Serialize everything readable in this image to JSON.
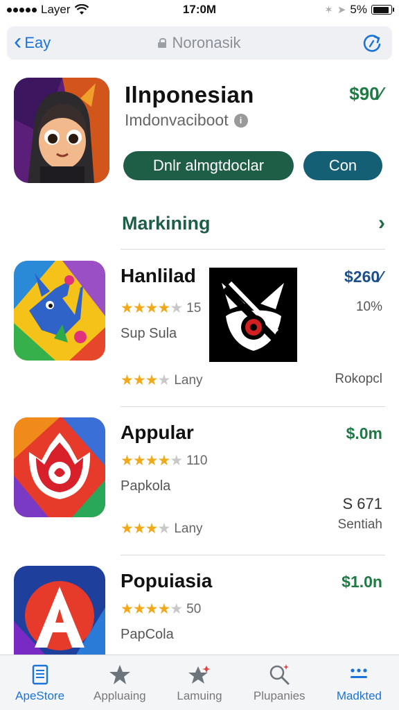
{
  "status_bar": {
    "carrier": "Layer",
    "time": "17:0M",
    "battery_percent_text": "5%"
  },
  "nav": {
    "back_label": "Eay",
    "title": "Noronasik"
  },
  "featured": {
    "title": "Ilnponesian",
    "subtitle": "Imdonvaciboot",
    "price": "$90⁄",
    "primary_button": "Dnlr almgtdoclar",
    "secondary_button": "Con"
  },
  "section": {
    "title": "Markining"
  },
  "apps": [
    {
      "title": "Hanlilad",
      "price": "$260⁄",
      "price_color": "#1a4f8c",
      "rating": 4.5,
      "rating_count": "15",
      "right_small": "10%",
      "subtitle": "Sup Sula",
      "rating2": 3.5,
      "rating2_label": "Lany",
      "bottom_right": "Rokopcl"
    },
    {
      "title": "Appular",
      "price": "$.0m",
      "price_color": "#1d7a43",
      "rating": 4.5,
      "rating_count": "110",
      "subtitle": "Papkola",
      "right_mid": "S 671",
      "rating2": 3.5,
      "rating2_label": "Lany",
      "bottom_right": "Sentiah"
    },
    {
      "title": "Popuiasia",
      "price": "$1.0n",
      "price_color": "#1d7a43",
      "rating": 4.5,
      "rating_count": "50",
      "subtitle": "PapCola"
    }
  ],
  "tabs": [
    {
      "label": "ApeStore",
      "icon": "doc-icon",
      "active": true
    },
    {
      "label": "Appluaing",
      "icon": "star-icon",
      "active": false
    },
    {
      "label": "Lamuing",
      "icon": "sparkle-star-icon",
      "active": false
    },
    {
      "label": "Plupanies",
      "icon": "search-icon",
      "active": false
    },
    {
      "label": "Madkted",
      "icon": "menu-icon",
      "active": true
    }
  ]
}
